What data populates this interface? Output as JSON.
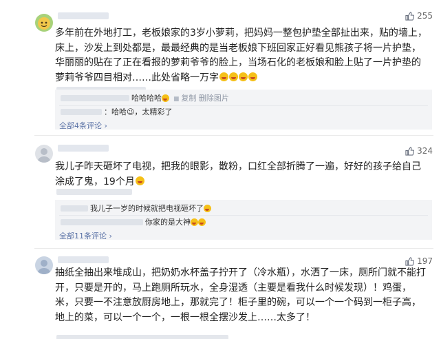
{
  "comments": [
    {
      "likes": "255",
      "text": "多年前在外地打工，老板娘家的3岁小萝莉，把妈妈一整包护垫全部扯出来，贴的墙上，床上，沙发上到处都是，最最经典的是当老板娘下班回家正好看见熊孩子将一片护垫，华丽丽的贴在了正在看报的萝莉爷爷的脸上，当场石化的老板娘和脸上贴了一片护垫的萝莉爷爷四目相对……此处省略一万字",
      "replies": [
        {
          "text": "哈哈哈哈",
          "actions": "复制  删除图片"
        },
        {
          "text": "：哈哈😉，太精彩了"
        }
      ],
      "more": "全部4条评论 ›"
    },
    {
      "likes": "324",
      "text": "我儿子昨天砸坏了电视，把我的眼影，散粉，口红全部折腾了一遍，好好的孩子给自己涂成了鬼，19个月",
      "replies": [
        {
          "text": "我儿子一岁的时候就把电视砸坏了"
        },
        {
          "text": "你家的是大神"
        }
      ],
      "more": "全部11条评论 ›"
    },
    {
      "likes": "197",
      "text": "抽纸全抽出来堆成山，把奶奶水杯盖子拧开了（冷水瓶），水洒了一床，厕所门就不能打开，只要是开的，马上跑厕所玩水，全身湿透（主要是看我什么时候发现）！鸡蛋，米，只要一不注意放厨房地上，那就完了！柜子里的碗，可以一个一个码到一柜子高，地上的菜，可以一个一个，一根一根全摆沙发上……太多了！"
    }
  ],
  "icons": {
    "thumb": "thumb-up-icon",
    "avatar_colors": [
      "#8fc36a",
      "#dfe2e7",
      "#c9d4e3"
    ]
  }
}
